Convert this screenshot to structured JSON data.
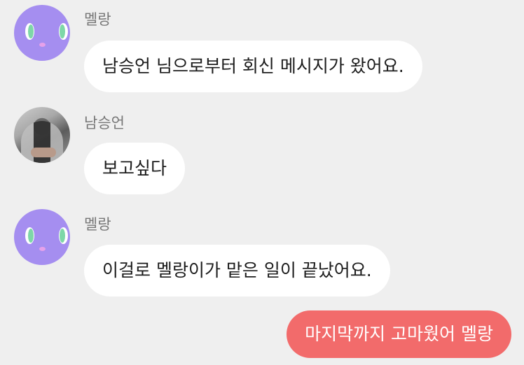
{
  "chat": {
    "messages": [
      {
        "sender": "멜랑",
        "avatar_icon": "purple-alien-avatar-icon",
        "text": "남승언 님으로부터 회신 메시지가 왔어요.",
        "direction": "incoming"
      },
      {
        "sender": "남승언",
        "avatar_icon": "person-photo-avatar-icon",
        "text": "보고싶다",
        "direction": "incoming"
      },
      {
        "sender": "멜랑",
        "avatar_icon": "purple-alien-avatar-icon",
        "text": "이걸로 멜랑이가 맡은 일이 끝났어요.",
        "direction": "incoming"
      },
      {
        "text": "마지막까지 고마웠어 멜랑",
        "direction": "outgoing"
      }
    ]
  },
  "colors": {
    "background": "#efefef",
    "incoming_bubble": "#ffffff",
    "outgoing_bubble": "#f26b6b",
    "sender_name": "#777777",
    "avatar_purple": "#a58ef0"
  }
}
